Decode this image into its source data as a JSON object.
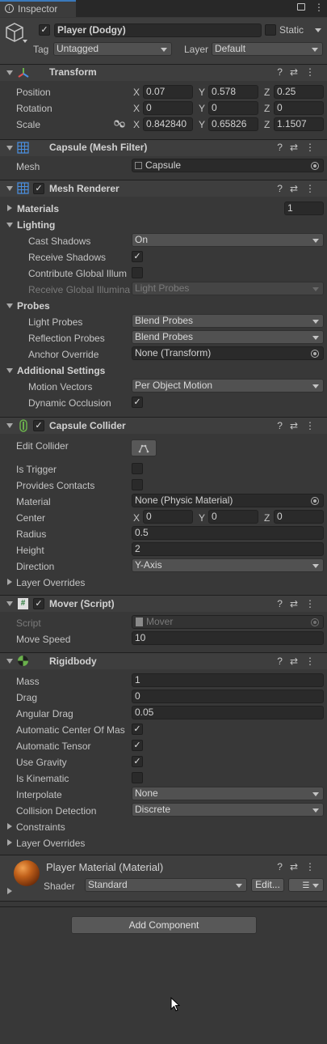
{
  "window": {
    "tab_title": "Inspector"
  },
  "object": {
    "name": "Player (Dodgy)",
    "static_label": "Static",
    "tag_label": "Tag",
    "tag_value": "Untagged",
    "layer_label": "Layer",
    "layer_value": "Default"
  },
  "transform": {
    "title": "Transform",
    "position_label": "Position",
    "rotation_label": "Rotation",
    "scale_label": "Scale",
    "position": {
      "x": "0.07",
      "y": "0.578",
      "z": "0.25"
    },
    "rotation": {
      "x": "0",
      "y": "0",
      "z": "0"
    },
    "scale": {
      "x": "0.842840",
      "y": "0.65826",
      "z": "1.1507"
    }
  },
  "axes": {
    "x": "X",
    "y": "Y",
    "z": "Z"
  },
  "mesh_filter": {
    "title": "Capsule (Mesh Filter)",
    "mesh_label": "Mesh",
    "mesh_value": "Capsule"
  },
  "mesh_renderer": {
    "title": "Mesh Renderer",
    "materials_label": "Materials",
    "materials_count": "1",
    "lighting_label": "Lighting",
    "cast_shadows_label": "Cast Shadows",
    "cast_shadows_value": "On",
    "receive_shadows_label": "Receive Shadows",
    "contribute_gi_label": "Contribute Global Illum",
    "receive_gi_label": "Receive Global Illumina",
    "receive_gi_value": "Light Probes",
    "probes_label": "Probes",
    "light_probes_label": "Light Probes",
    "light_probes_value": "Blend Probes",
    "reflection_probes_label": "Reflection Probes",
    "reflection_probes_value": "Blend Probes",
    "anchor_override_label": "Anchor Override",
    "anchor_override_value": "None (Transform)",
    "additional_label": "Additional Settings",
    "motion_vectors_label": "Motion Vectors",
    "motion_vectors_value": "Per Object Motion",
    "dynamic_occlusion_label": "Dynamic Occlusion"
  },
  "capsule_collider": {
    "title": "Capsule Collider",
    "edit_collider_label": "Edit Collider",
    "is_trigger_label": "Is Trigger",
    "provides_contacts_label": "Provides Contacts",
    "material_label": "Material",
    "material_value": "None (Physic Material)",
    "center_label": "Center",
    "center": {
      "x": "0",
      "y": "0",
      "z": "0"
    },
    "radius_label": "Radius",
    "radius_value": "0.5",
    "height_label": "Height",
    "height_value": "2",
    "direction_label": "Direction",
    "direction_value": "Y-Axis",
    "layer_overrides_label": "Layer Overrides"
  },
  "mover": {
    "title": "Mover (Script)",
    "script_label": "Script",
    "script_value": "Mover",
    "move_speed_label": "Move Speed",
    "move_speed_value": "10"
  },
  "rigidbody": {
    "title": "Rigidbody",
    "mass_label": "Mass",
    "mass_value": "1",
    "drag_label": "Drag",
    "drag_value": "0",
    "angular_drag_label": "Angular Drag",
    "angular_drag_value": "0.05",
    "auto_com_label": "Automatic Center Of Mas",
    "auto_tensor_label": "Automatic Tensor",
    "use_gravity_label": "Use Gravity",
    "is_kinematic_label": "Is Kinematic",
    "interpolate_label": "Interpolate",
    "interpolate_value": "None",
    "collision_label": "Collision Detection",
    "collision_value": "Discrete",
    "constraints_label": "Constraints",
    "layer_overrides_label": "Layer Overrides"
  },
  "material": {
    "title": "Player Material (Material)",
    "shader_label": "Shader",
    "shader_value": "Standard",
    "edit_label": "Edit..."
  },
  "add_component_label": "Add Component",
  "icons": {
    "check": "✓",
    "help": "?",
    "preset": "⇄",
    "more": "⋮",
    "lock": "🔒"
  }
}
